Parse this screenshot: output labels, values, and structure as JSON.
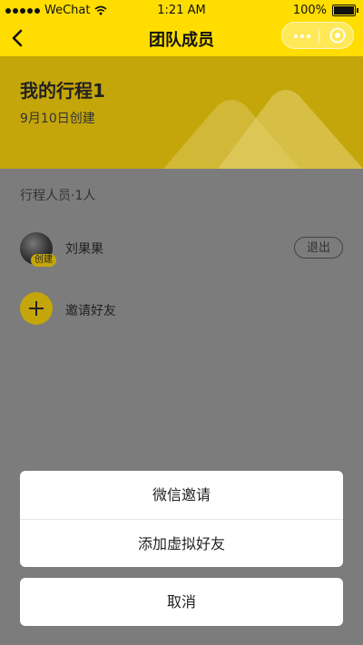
{
  "status_bar": {
    "carrier": "WeChat",
    "time": "1:21 AM",
    "battery": "100%"
  },
  "nav": {
    "title": "团队成员"
  },
  "trip": {
    "title": "我的行程1",
    "subtitle": "9月10日创建"
  },
  "members": {
    "header": "行程人员·1人",
    "list": [
      {
        "name": "刘果果",
        "badge": "创建",
        "action": "退出"
      }
    ],
    "invite_label": "邀请好友"
  },
  "action_sheet": {
    "options": [
      "微信邀请",
      "添加虚拟好友"
    ],
    "cancel": "取消"
  },
  "colors": {
    "accent": "#ffdd00",
    "overlay_accent": "#c4a60a"
  }
}
